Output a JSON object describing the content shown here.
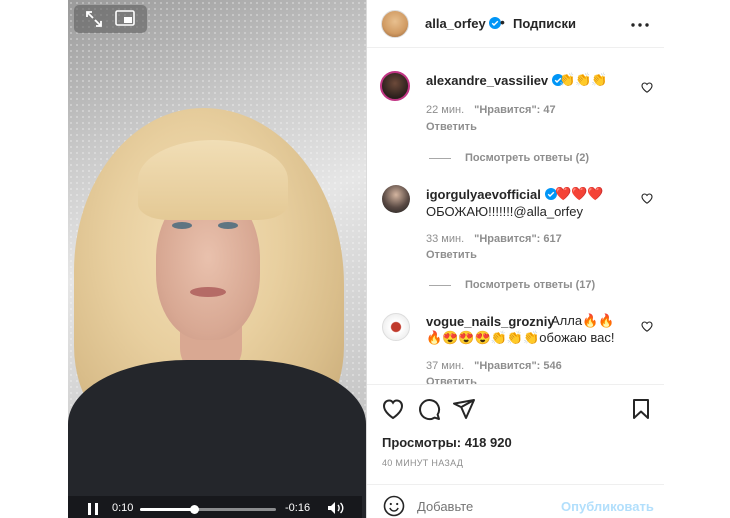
{
  "video": {
    "current_time": "0:10",
    "remaining_time": "-0:16",
    "progress": 0.4,
    "playing": true
  },
  "post": {
    "author": "alla_orfey",
    "separator": "•",
    "follow_state": "Подписки",
    "views": "Просмотры: 418 920",
    "posted": "40 МИНУТ НАЗАД"
  },
  "comments": [
    {
      "user": "alexandre_vassiliev",
      "text": "👏👏👏",
      "time": "22 мин.",
      "likes": "\"Нравится\": 47",
      "reply": "Ответить",
      "replies": "Посмотреть ответы (2)"
    },
    {
      "user": "igorgulyaevofficial",
      "text": "❤️❤️❤️",
      "text2": "ОБОЖАЮ!!!!!!!@alla_orfey",
      "time": "33 мин.",
      "likes": "\"Нравится\": 617",
      "reply": "Ответить",
      "replies": "Посмотреть ответы (17)"
    },
    {
      "user": "vogue_nails_grozniy",
      "text": "Алла🔥🔥",
      "text2": "🔥😍😍😍👏👏👏обожаю вас!",
      "time": "37 мин.",
      "likes": "\"Нравится\": 546",
      "reply": "Ответить"
    }
  ],
  "compose": {
    "placeholder": "Добавьте",
    "publish_label": "Опубликовать"
  },
  "colors": {
    "accent": "#0095f6",
    "publish_disabled": "#b2dffc",
    "heart": "#ed4956"
  },
  "icons": [
    "expand-icon",
    "pip-icon",
    "pause-icon",
    "volume-icon",
    "verified-icon",
    "more-icon",
    "heart-icon",
    "comment-icon",
    "share-icon",
    "bookmark-icon",
    "emoji-icon"
  ]
}
